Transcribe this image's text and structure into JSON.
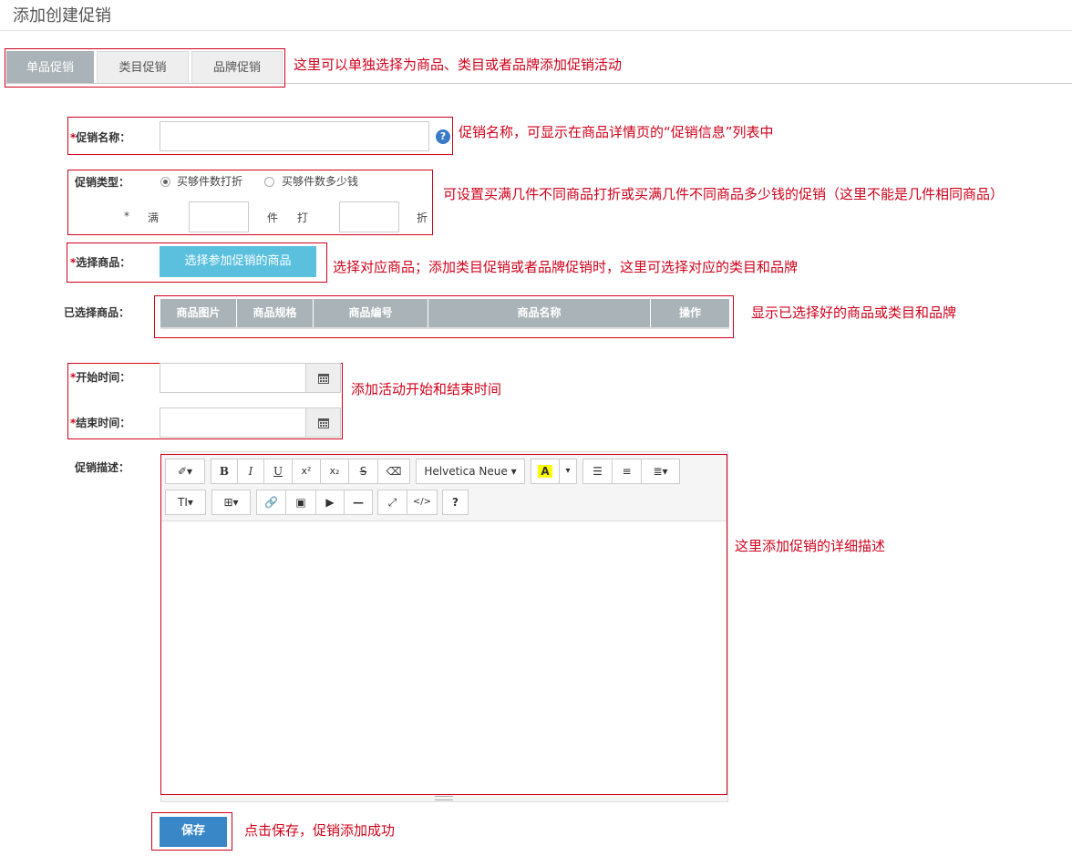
{
  "page": {
    "title": "添加创建促销"
  },
  "tabs": [
    {
      "label": "单品促销",
      "active": true
    },
    {
      "label": "类目促销",
      "active": false
    },
    {
      "label": "品牌促销",
      "active": false
    }
  ],
  "notes": {
    "tabs": "这里可以单独选择为商品、类目或者品牌添加促销活动",
    "name": "促销名称，可显示在商品详情页的“促销信息”列表中",
    "type": "可设置买满几件不同商品打折或买满几件不同商品多少钱的促销（这里不能是几件相同商品）",
    "select": "选择对应商品；添加类目促销或者品牌促销时，这里可选择对应的类目和品牌",
    "selected": "显示已选择好的商品或类目和品牌",
    "time": "添加活动开始和结束时间",
    "desc": "这里添加促销的详细描述",
    "save": "点击保存，促销添加成功"
  },
  "form": {
    "name_label": "促销名称：",
    "name_value": "",
    "type_label": "促销类型：",
    "type_options": [
      {
        "label": "买够件数打折",
        "selected": true
      },
      {
        "label": "买够件数多少钱",
        "selected": false
      }
    ],
    "condition": {
      "star": "*",
      "man": "满",
      "jian": "件",
      "da": "打",
      "zhe": "折",
      "count_value": "",
      "discount_value": ""
    },
    "select_label": "选择商品：",
    "select_button": "选择参加促销的商品",
    "selected_label": "已选择商品：",
    "table_headers": [
      "商品图片",
      "商品规格",
      "商品编号",
      "商品名称",
      "操作"
    ],
    "start_label": "开始时间：",
    "start_value": "",
    "end_label": "结束时间：",
    "end_value": "",
    "desc_label": "促销描述：",
    "save_button": "保存",
    "required_mark": "*"
  },
  "editor": {
    "font_name": "Helvetica Neue",
    "content": ""
  }
}
